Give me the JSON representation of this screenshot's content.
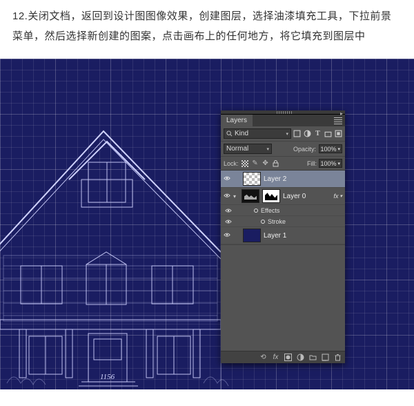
{
  "instruction": "12.关闭文档，返回到设计图图像效果，创建图层，选择油漆填充工具，下拉前景菜单，然后选择新创建的图案，点击画布上的任何地方，将它填充到图层中",
  "house_number": "1156",
  "panel": {
    "tab": "Layers",
    "filter": {
      "kind_label": "Kind"
    },
    "blend": {
      "mode": "Normal",
      "opacity_label": "Opacity:",
      "opacity_value": "100%"
    },
    "lock": {
      "label": "Lock:",
      "fill_label": "Fill:",
      "fill_value": "100%"
    },
    "layers": [
      {
        "name": "Layer 2",
        "selected": true,
        "visible": true,
        "thumb": "checker"
      },
      {
        "name": "Layer 0",
        "visible": true,
        "thumb": "dark",
        "mask": true,
        "fx": true,
        "effects_label": "Effects",
        "stroke_label": "Stroke"
      },
      {
        "name": "Layer 1",
        "visible": true,
        "thumb": "navy"
      }
    ],
    "footer_fx": "fx"
  }
}
